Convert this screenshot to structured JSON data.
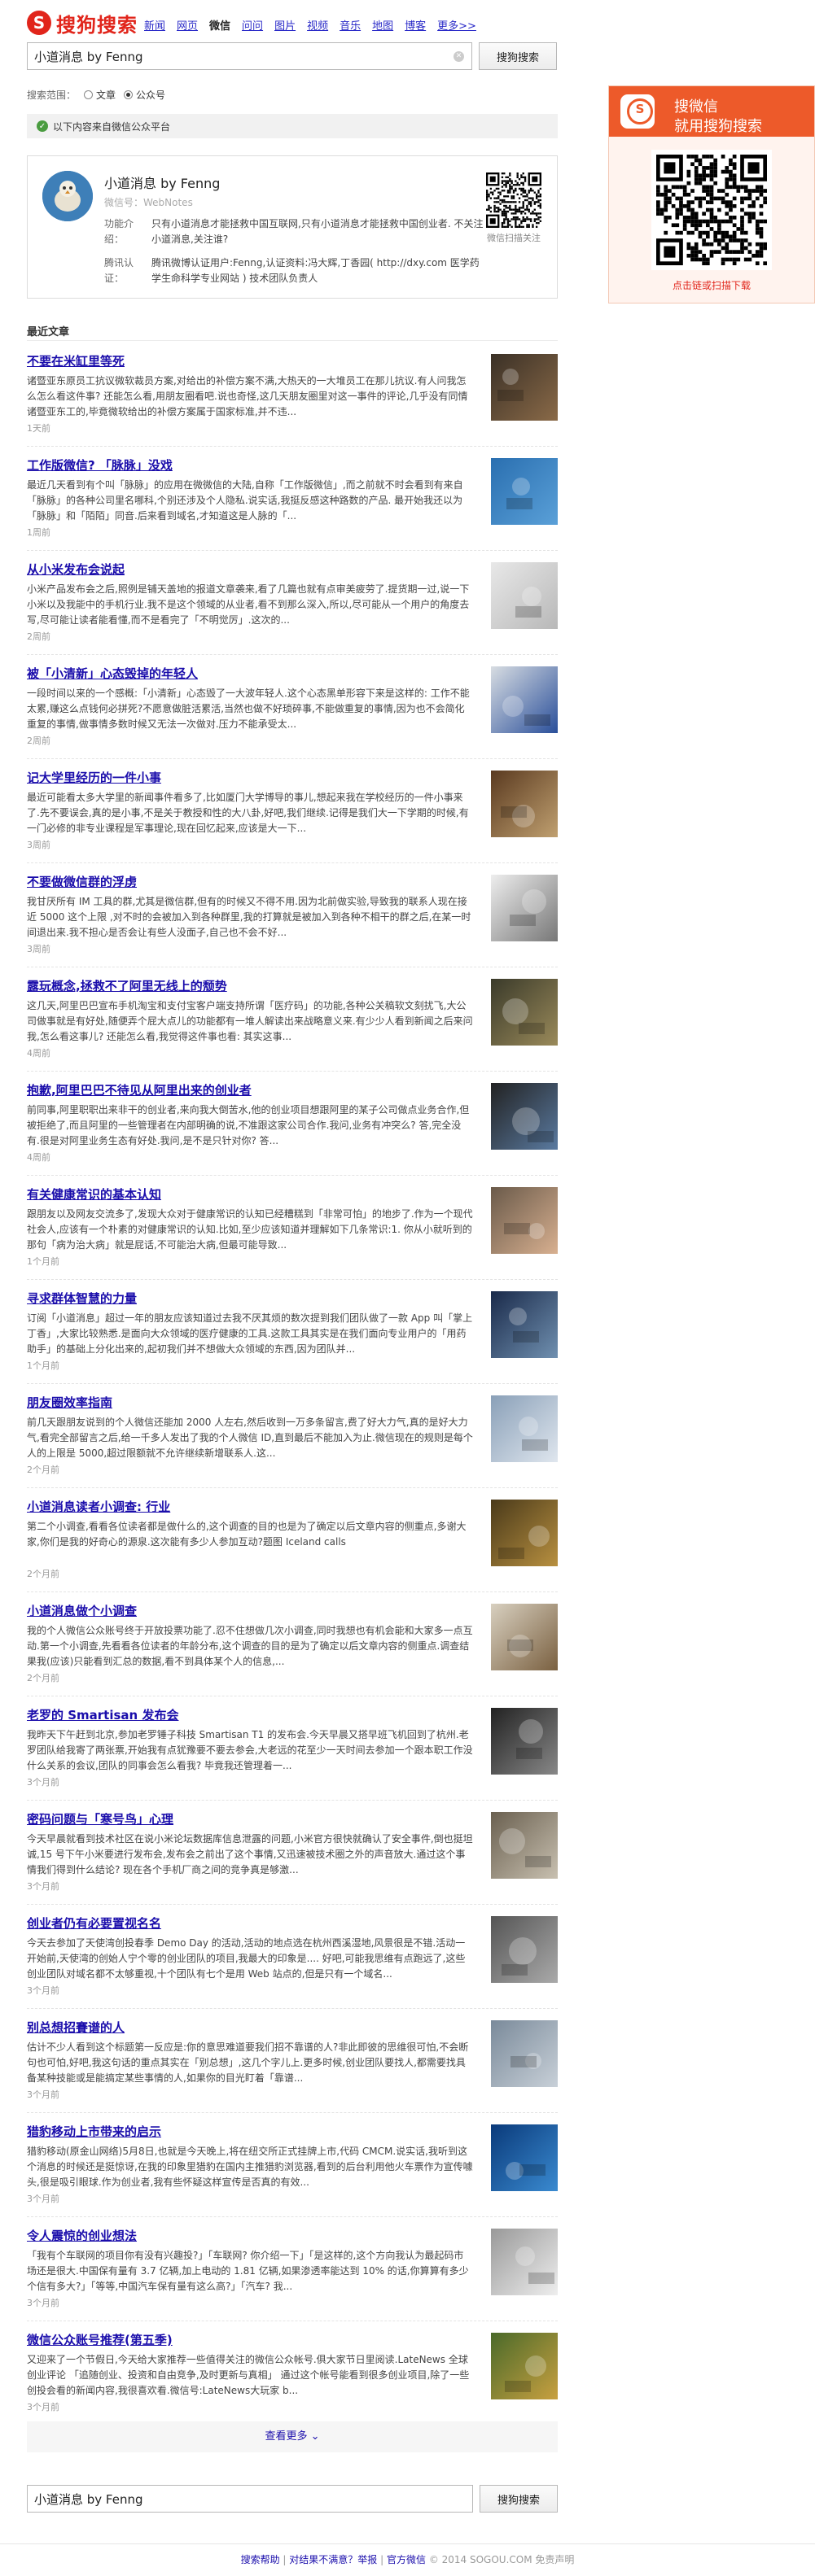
{
  "logo": {
    "text": "搜狗搜索"
  },
  "nav": {
    "items": [
      {
        "label": "新闻",
        "current": false
      },
      {
        "label": "网页",
        "current": false
      },
      {
        "label": "微信",
        "current": true
      },
      {
        "label": "问问",
        "current": false
      },
      {
        "label": "图片",
        "current": false
      },
      {
        "label": "视频",
        "current": false
      },
      {
        "label": "音乐",
        "current": false
      },
      {
        "label": "地图",
        "current": false
      },
      {
        "label": "博客",
        "current": false
      },
      {
        "label": "更多>>",
        "current": false
      }
    ]
  },
  "search": {
    "query": "小道消息 by Fenng",
    "button": "搜狗搜索"
  },
  "scope": {
    "label": "搜索范围：",
    "option_article": "文章",
    "option_account": "公众号",
    "selected": "公众号"
  },
  "notice": {
    "text": "以下内容来自微信公众平台"
  },
  "account": {
    "name": "小道消息 by Fenng",
    "wechat_id": "微信号：WebNotes",
    "func_key": "功能介绍：",
    "func_val": "只有小道消息才能拯救中国互联网,只有小道消息才能拯救中国创业者. 不关注小道消息,关注谁?",
    "auth_key": "腾讯认证：",
    "auth_val": "腾讯微博认证用户:Fenng,认证资料:冯大辉,丁香园( http://dxy.com 医学药学生命科学专业网站 ) 技术团队负责人",
    "qr_caption": "微信扫描关注"
  },
  "recent_label": "最近文章",
  "results": [
    {
      "title": "不要在米缸里等死",
      "text": "诸暨亚东原员工抗议微软裁员方案,对给出的补偿方案不满,大热天的一大堆员工在那儿抗议.有人问我怎么怎么看这件事? 还能怎么看,用朋友圈看吧.说也奇怪,这几天朋友圈里对这一事件的评论,几乎没有同情诸暨亚东工的,毕竟微软给出的补偿方案属于国家标准,并不违...",
      "time": "1天前"
    },
    {
      "title": "工作版微信? 「脉脉」没戏",
      "text": "最近几天看到有个叫「脉脉」的应用在微微信的大陆,自称「工作版微信」,而之前就不时会看到有来自「脉脉」的各种公司里名哪科,个别还涉及个人隐私.说实话,我挺反感这种路数的产品. 最开始我还以为「脉脉」和「陌陌」同音.后来看到域名,才知道这是人脉的「...",
      "time": "1周前"
    },
    {
      "title": "从小米发布会说起",
      "text": "小米产品发布会之后,照例是铺天盖地的报道文章袭来,看了几篇也就有点审美疲劳了.提货期一过,说一下小米以及我能中的手机行业.我不是这个领域的从业者,看不到那么深入,所以,尽可能从一个用户的角度去写,尽可能让读者能看懂,而不是看完了「不明觉厉」.这次的...",
      "time": "2周前"
    },
    {
      "title": "被「小清新」心态毁掉的年轻人",
      "text": "一段时间以来的一个感概:「小清新」心态毁了一大波年轻人.这个心态黑单形容下来是这样的: 工作不能太累,赚这么点钱何必拼死?不愿意做脏活累活,当然也做不好琐碎事,不能做重复的事情,因为也不会简化重复的事情,做事情多数时候又无法一次做对.压力不能承受太...",
      "time": "2周前"
    },
    {
      "title": "记大学里经历的一件小事",
      "text": "最近可能看太多大学里的新闻事件看多了,比如厦门大学博导的事儿,想起来我在学校经历的一件小事来了.先不要误会,真的是小事,不是关于教授和性的大八卦,好吧,我们继续.记得是我们大一下学期的时候,有一门必修的非专业课程是军事理论,现在回忆起来,应该是大一下...",
      "time": "3周前"
    },
    {
      "title": "不要做微信群的浮虏",
      "text": "我甘厌所有 IM 工具的群,尤其是微信群,但有的时候又不得不用.因为北前做实验,导致我的联系人现在接近 5000 这个上限 ,对不时的会被加入到各种群里,我的打算就是被加入到各种不相干的群之后,在某一时间退出来.我不担心是否会让有些人没面子,自己也不会不好...",
      "time": "3周前"
    },
    {
      "title": "露玩概念,拯救不了阿里无线上的颓势",
      "text": "这几天,阿里巴巴宣布手机淘宝和支付宝客户端支持所谓「医疗码」的功能,各种公关稿软文刻扰飞,大公司做事就是有好处,随便弄个屁大点儿的功能都有一堆人解读出来战略意义来.有少少人看到新闻之后来问我,怎么看这事儿? 还能怎么看,我觉得这件事也看: 其实这事...",
      "time": "4周前"
    },
    {
      "title": "抱歉,阿里巴巴不待见从阿里出来的创业者",
      "text": "前同事,阿里职职出来非干的创业者,来向我大倒苦水,他的创业项目想跟阿里的某子公司做点业务合作,但被拒绝了,而且阿里的一些管理者在内部明确的说,不准跟这家公司合作.我问,业务有冲突么? 答,完全没有.很是对阿里业务生态有好处.我问,是不是只针对你? 答...",
      "time": "4周前"
    },
    {
      "title": "有关健康常识的基本认知",
      "text": "跟朋友以及网友交流多了,发现大众对于健康常识的认知已经糟糕到「非常可怕」的地步了.作为一个现代社会人,应该有一个朴素的对健康常识的认知.比如,至少应该知道并理解如下几条常识:1. 你从小就听到的那句「病为治大病」就是屁话,不可能治大病,但最可能导致...",
      "time": "1个月前"
    },
    {
      "title": "寻求群体智慧的力量",
      "text": "订阅「小道消息」超过一年的朋友应该知道过去我不厌其烦的数次提到我们团队做了一款 App 叫「掌上丁香」,大家比较熟悉.是面向大众领域的医疗健康的工具.这款工具其实是在我们面向专业用户的「用药助手」的基础上分化出来的,起初我们并不想做大众领域的东西,因为团队并...",
      "time": "1个月前"
    },
    {
      "title": "朋友圈效率指南",
      "text": "前几天跟朋友说到的个人微信还能加 2000 人左右,然后收到一万多条留言,费了好大力气,真的是好大力气,看完全部留言之后,给一千多人发出了我的个人微信 ID,直到最后不能加入为止.微信现在的规则是每个人的上限是 5000,超过限额就不允许继续新增联系人.这...",
      "time": "2个月前"
    },
    {
      "title": "小道消息读者小调查: 行业",
      "text": "第二个小调查,看看各位读者都是做什么的,这个调查的目的也是为了确定以后文章内容的侧重点,多谢大家,你们是我的好奇心的源泉.这次能有多少人参加互动?题图 Iceland calls",
      "time": "2个月前"
    },
    {
      "title": "小道消息做个小调查",
      "text": "我的个人微信公众账号终于开放投票功能了.忍不住想做几次小调查,同时我想也有机会能和大家多一点互动.第一个小调查,先看看各位读者的年龄分布,这个调查的目的是为了确定以后文章内容的侧重点.调查结果我(应该)只能看到汇总的数据,看不到具体某个人的信息,...",
      "time": "2个月前"
    },
    {
      "title": "老罗的 Smartisan 发布会",
      "text": "我昨天下午赶到北京,参加老罗锤子科技 Smartisan T1 的发布会.今天早晨又搭早班飞机回到了杭州.老罗团队给我寄了两张票,开始我有点犹豫要不要去参会,大老远的花至少一天时间去参加一个跟本职工作没什么关系的会议,团队的同事会怎么看我? 毕竟我还管理着一...",
      "time": "3个月前"
    },
    {
      "title": "密码问题与「寒号鸟」心理",
      "text": "今天早晨就看到技术社区在说小米论坛数据库信息泄露的问题,小米官方很快就确认了安全事件,倒也挺坦诚,15 号下午小米要进行发布会,发布会之前出了这个事情,又迅速被技术圈之外的声音放大.通过这个事情我们得到什么结论? 现在各个手机厂商之间的竞争真是够激...",
      "time": "3个月前"
    },
    {
      "title": "创业者仍有必要置视名名",
      "text": "今天去参加了天使湾创投春季 Demo Day 的活动,活动的地点选在杭州西溪湿地,风景很是不错.活动一开始前,天使湾的创始人宁个零的创业团队的项目,我最大的印象是.... 好吧,可能我思维有点跑远了,这些创业团队对域名都不太够重视,十个团队有七个是用 Web 站点的,但是只有一个域名...",
      "time": "3个月前"
    },
    {
      "title": "别总想招賽谱的人",
      "text": "估计不少人看到这个标题第一反应是:你的意思难道要我们招不靠谱的人?非此即彼的思维很可怕,不会断句也可怕,好吧,我这句话的重点其实在「别总想」,这几个字儿上.更多时候,创业团队要找人,都需要找具备某种技能或是能搞定某些事情的人,如果你的目光盯着「靠谱...",
      "time": "3个月前"
    },
    {
      "title": "猎豹移动上市带来的启示",
      "text": "猎豹移动(原金山网络)5月8日,也就是今天晚上,将在纽交所正式挂牌上市,代码 CMCM.说实话,我听到这个消息的时候还是挺惊讶,在我的印象里猎豹在国内主推猎豹浏览器,看到的后台利用他火车票作为宣传噱头,很是吸引眼球.作为创业者,我有些怀疑这样宣传是否真的有效...",
      "time": "3个月前"
    },
    {
      "title": "令人震惊的创业想法",
      "text": "「我有个车联网的项目你有没有兴趣投?」「车联网? 你介绍一下」「是这样的,这个方向我认为最起码市场还是很大.中国保有量有 3.7 亿辆,加上电动的 1.81 亿辆,如果渗透率能达到 10% 的话,你算算有多少个信有多大?」「等等,中国汽车保有量有这么高?」「汽车? 我...",
      "time": "3个月前"
    },
    {
      "title": "微信公众账号推荐(第五季)",
      "text": "又迎来了一个节假日,今天给大家推荐一些值得关注的微信公众帐号.俱大家节日里阅读.LateNews 全球创业评论 「追随创业、投资和自由竞争,及时更新与真相」 通过这个帐号能看到很多创业项目,除了一些创投会看的新闻内容,我很喜欢看.微信号:LateNews大玩家 b...",
      "time": "3个月前"
    }
  ],
  "more": "查看更多",
  "footer": {
    "help": "搜索帮助",
    "feedback": "对结果不满意？举报",
    "official": "官方微信",
    "copyright": "© 2014 SOGOU.COM",
    "disclaimer": "免责声明"
  },
  "promo": {
    "line1": "搜微信",
    "line2": "就用搜狗搜索",
    "caption": "点击链或扫描下载"
  },
  "colors": {
    "brand": "#e1251b",
    "promo": "#ed5a2a",
    "link": "#1a0dab"
  },
  "icons": [
    "sogou-logo-icon",
    "clear-icon",
    "wechat-icon",
    "qr-code-icon",
    "chevron-down-icon"
  ]
}
